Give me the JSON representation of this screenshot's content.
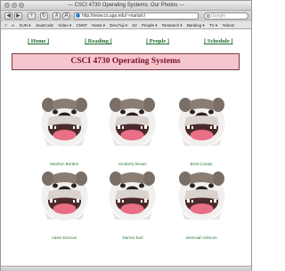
{
  "window": {
    "title": "--- CSCI 4730 Operating Systems: Our Photos ---"
  },
  "toolbar": {
    "back": "◀",
    "forward": "▶",
    "add": "+",
    "reload": "↻",
    "font_small": "A",
    "font_large": "A",
    "url": "http://www.cs.uga.edu/~maria/cl",
    "search_placeholder": "Google"
  },
  "bookmarks": [
    "□",
    "∞",
    "SUN ▾",
    "JavaCode",
    "Video ▾",
    "CNNT",
    "News ▾",
    "Dev.Fuji ▾",
    "S2",
    "People ▾",
    "Research ▾",
    "Banking ▾",
    "TV ▾",
    "Yahoo!"
  ],
  "nav": {
    "home": "[ Home ]",
    "reading": "[ Reading ]",
    "people": "[ People ]",
    "schedule": "[ Schedule ]"
  },
  "page": {
    "heading": "CSCI 4730 Operating Systems"
  },
  "photos": [
    {
      "name": "Stephen Borden"
    },
    {
      "name": "Kimberly Brown"
    },
    {
      "name": "Brett Conaty"
    },
    {
      "name": "Adam Duncan"
    },
    {
      "name": "Darren Earl"
    },
    {
      "name": "Jeremiah Gilmore"
    }
  ]
}
